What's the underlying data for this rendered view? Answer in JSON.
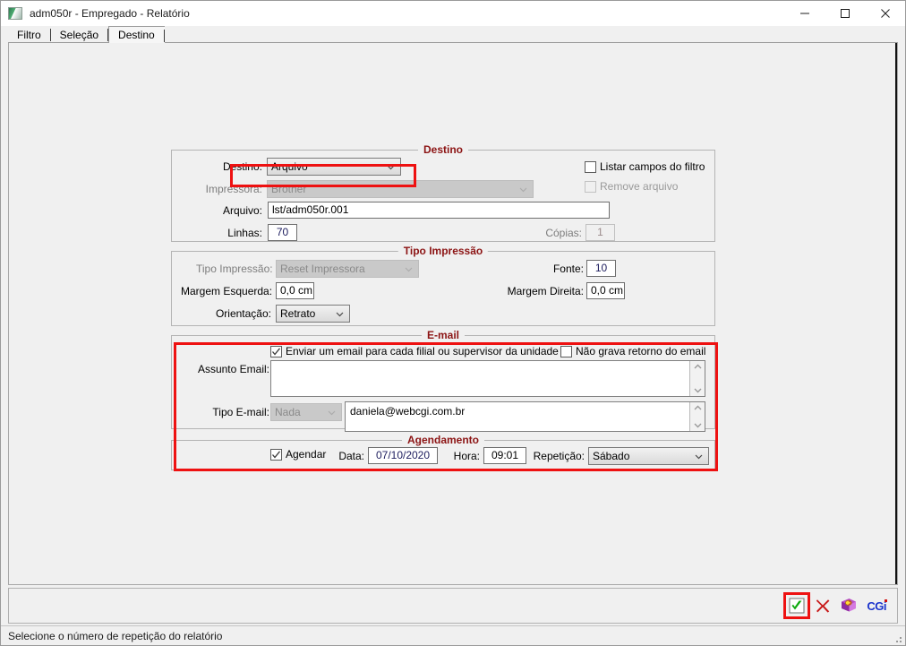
{
  "window": {
    "title": "adm050r - Empregado - Relatório",
    "icon": "app-icon",
    "minimize_label": "Minimizar",
    "maximize_label": "Maximizar",
    "close_label": "Fechar"
  },
  "tabs": [
    {
      "label": "Filtro",
      "active": false
    },
    {
      "label": "Seleção",
      "active": false
    },
    {
      "label": "Destino",
      "active": true
    }
  ],
  "destino_group": {
    "legend": "Destino",
    "destino_label": "Destino:",
    "destino_value": "Arquivo",
    "impressora_label": "Impressora:",
    "impressora_value": "Brother",
    "arquivo_label": "Arquivo:",
    "arquivo_value": "lst/adm050r.001",
    "linhas_label": "Linhas:",
    "linhas_value": "70",
    "copias_label": "Cópias:",
    "copias_value": "1",
    "listar_campos_label": "Listar campos do filtro",
    "listar_campos_checked": false,
    "remove_arquivo_label": "Remove arquivo",
    "remove_arquivo_checked": false
  },
  "tipo_impressao_group": {
    "legend": "Tipo Impressão",
    "tipo_label": "Tipo Impressão:",
    "tipo_value": "Reset Impressora",
    "fonte_label": "Fonte:",
    "fonte_value": "10",
    "margem_esq_label": "Margem Esquerda:",
    "margem_esq_value": "0,0 cm",
    "margem_dir_label": "Margem Direita:",
    "margem_dir_value": "0,0 cm",
    "orientacao_label": "Orientação:",
    "orientacao_value": "Retrato"
  },
  "email_group": {
    "legend": "E-mail",
    "enviar_label": "Enviar um email para cada filial ou supervisor da unidade",
    "enviar_checked": true,
    "nao_grava_label": "Não grava retorno do email",
    "nao_grava_checked": false,
    "assunto_label": "Assunto Email:",
    "assunto_value": "",
    "tipo_email_label": "Tipo E-mail:",
    "tipo_email_value": "Nada",
    "destinatarios_value": "daniela@webcgi.com.br"
  },
  "agendamento_group": {
    "legend": "Agendamento",
    "agendar_label": "Agendar",
    "agendar_checked": true,
    "data_label": "Data:",
    "data_value": "07/10/2020",
    "hora_label": "Hora:",
    "hora_value": "09:01",
    "repeticao_label": "Repetição:",
    "repeticao_value": "Sábado"
  },
  "toolbar": {
    "confirm_label": "Confirmar",
    "cancel_label": "Cancelar",
    "help_label": "Ajuda",
    "brand_label": "CGi"
  },
  "statusbar": {
    "message": "Selecione o número de repetição do relatório"
  },
  "colors": {
    "highlight": "#ee1111",
    "legend": "#8c1414",
    "input_text": "#202060",
    "brand": "#1a33cc",
    "window_bg": "#f0f0f0"
  }
}
